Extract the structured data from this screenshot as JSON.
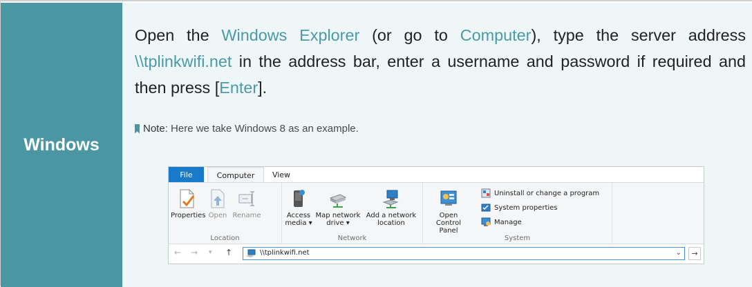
{
  "os_label": "Windows",
  "instruction": {
    "t1": "Open the ",
    "h1": "Windows Explorer",
    "t2": " (or go to ",
    "h2": "Computer",
    "t3": "), type the server address ",
    "h3": "\\\\tplinkwifi.net",
    "t4": " in the address bar, enter a username and password if required and then press [",
    "h4": "Enter",
    "t5": "]."
  },
  "note": {
    "label": "Note",
    "text": ": Here we take Windows 8 as an example."
  },
  "colors": {
    "accent": "#4a97a3",
    "file_tab": "#1979ca",
    "highlight_text": "#4a9aa7"
  },
  "explorer": {
    "tabs": [
      "File",
      "Computer",
      "View"
    ],
    "location": {
      "title": "Location",
      "properties": "Properties",
      "open": "Open",
      "rename": "Rename"
    },
    "network": {
      "title": "Network",
      "access_media_1": "Access",
      "access_media_2": "media ▾",
      "map_drive_1": "Map network",
      "map_drive_2": "drive ▾",
      "add_location_1": "Add a network",
      "add_location_2": "location"
    },
    "system": {
      "title": "System",
      "open_cp_1": "Open Control",
      "open_cp_2": "Panel",
      "uninstall": "Uninstall or change a program",
      "sys_props": "System properties",
      "manage": "Manage"
    },
    "address": "\\\\tplinkwifi.net",
    "nav": {
      "back": "←",
      "forward": "→",
      "recent": "▾",
      "up": "↑",
      "dropdown": "⌄",
      "go": "→"
    }
  }
}
